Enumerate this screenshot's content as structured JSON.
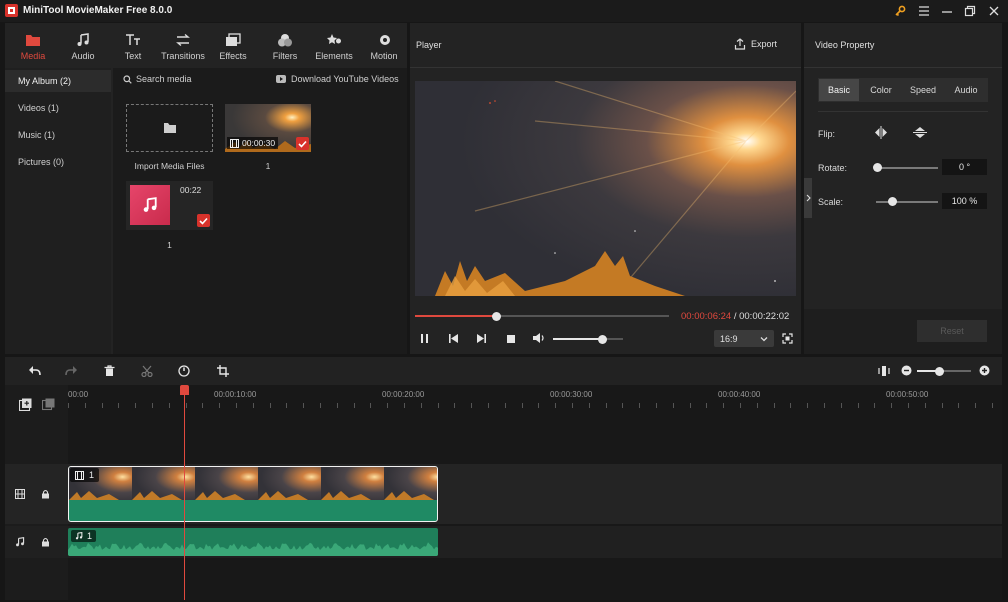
{
  "app": {
    "title": "MiniTool MovieMaker Free 8.0.0"
  },
  "toolbar": {
    "items": [
      {
        "label": "Media",
        "icon": "folder-icon"
      },
      {
        "label": "Audio",
        "icon": "music-note-icon"
      },
      {
        "label": "Text",
        "icon": "text-icon"
      },
      {
        "label": "Transitions",
        "icon": "transitions-icon"
      },
      {
        "label": "Effects",
        "icon": "effects-icon"
      },
      {
        "label": "Filters",
        "icon": "filters-icon"
      },
      {
        "label": "Elements",
        "icon": "elements-icon"
      },
      {
        "label": "Motion",
        "icon": "motion-icon"
      }
    ]
  },
  "media": {
    "sidebar": [
      "My Album (2)",
      "Videos (1)",
      "Music (1)",
      "Pictures (0)"
    ],
    "search_placeholder": "Search media",
    "download_label": "Download YouTube Videos",
    "import_label": "Import Media Files",
    "items": [
      {
        "kind": "video",
        "duration": "00:00:30",
        "name": "1"
      },
      {
        "kind": "audio",
        "duration": "00:22",
        "name": "1"
      }
    ]
  },
  "player": {
    "title": "Player",
    "export_label": "Export",
    "current_time": "00:00:06:24",
    "separator": " / ",
    "total_time": "00:00:22:02",
    "progress": 0.32,
    "volume": 0.7,
    "aspect": "16:9"
  },
  "properties": {
    "title": "Video Property",
    "tabs": [
      "Basic",
      "Color",
      "Speed",
      "Audio"
    ],
    "active_tab": "Basic",
    "flip_label": "Flip:",
    "rotate_label": "Rotate:",
    "rotate_value": "0 °",
    "scale_label": "Scale:",
    "scale_value": "100 %",
    "reset_label": "Reset"
  },
  "timeline": {
    "ruler": [
      "00:00",
      "00:00:10:00",
      "00:00:20:00",
      "00:00:30:00",
      "00:00:40:00",
      "00:00:50:00"
    ],
    "video_clip_label": "1",
    "audio_clip_label": "1"
  },
  "colors": {
    "accent": "#e0493e",
    "clip_green": "#1f8a64",
    "audio_green": "#3aa878"
  }
}
